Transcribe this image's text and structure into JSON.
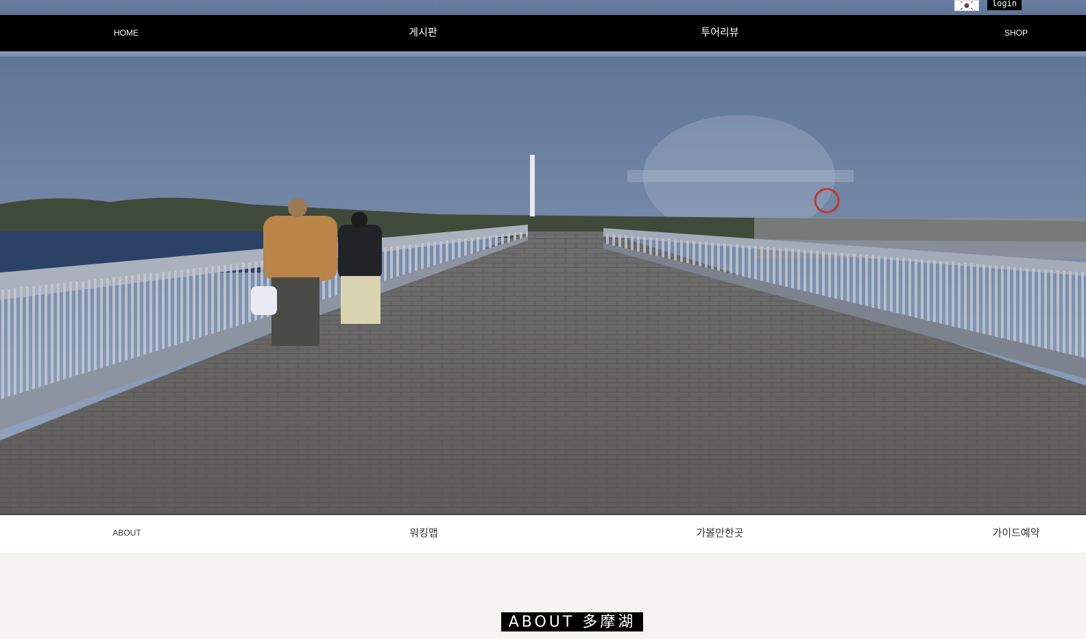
{
  "utility": {
    "language_icon": "korea-flag-icon",
    "login_label": "login"
  },
  "nav": {
    "items": [
      {
        "label": "HOME"
      },
      {
        "label": "게시판"
      },
      {
        "label": "투어리뷰"
      },
      {
        "label": "SHOP"
      }
    ]
  },
  "hero": {
    "image": "lakeside-bridge-walkway-photo"
  },
  "subnav": {
    "items": [
      {
        "label": "ABOUT"
      },
      {
        "label": "워킹맵"
      },
      {
        "label": "가볼만한곳"
      },
      {
        "label": "가이드예약"
      }
    ]
  },
  "about": {
    "title": "ABOUT 多摩湖"
  },
  "colors": {
    "nav_bg": "#000000",
    "utility_bg": "#6a7fa1",
    "page_bg": "#f5f4f1",
    "subnav_bg": "#ffffff"
  }
}
